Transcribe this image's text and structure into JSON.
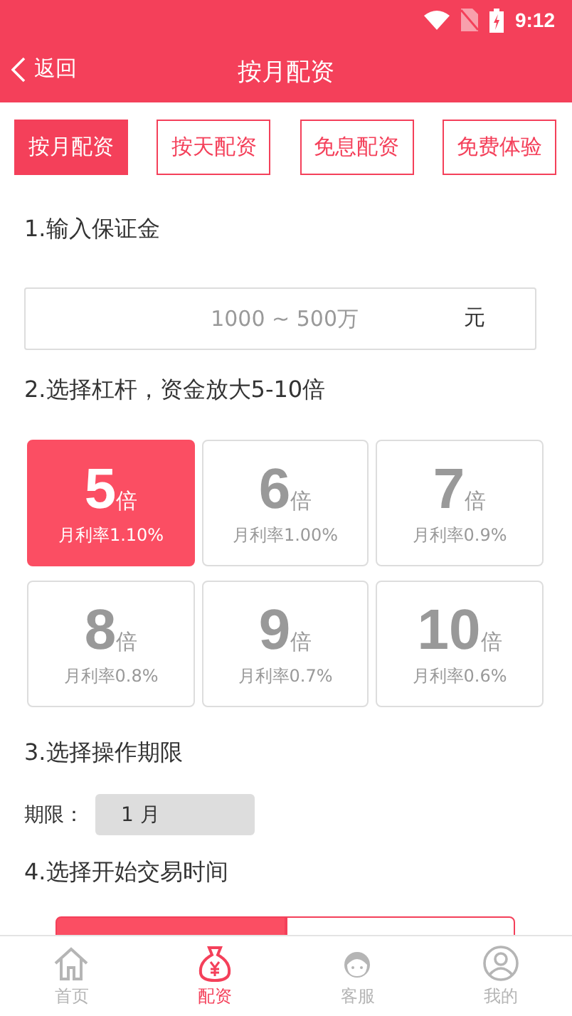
{
  "status_bar": {
    "time": "9:12"
  },
  "header": {
    "back": "返回",
    "title": "按月配资"
  },
  "tabs": [
    {
      "label": "按月配资",
      "selected": true
    },
    {
      "label": "按天配资",
      "selected": false
    },
    {
      "label": "免息配资",
      "selected": false
    },
    {
      "label": "免费体验",
      "selected": false
    }
  ],
  "deposit": {
    "heading": "1.输入保证金",
    "placeholder": "1000 ~ 500万",
    "unit": "元"
  },
  "leverage": {
    "heading": "2.选择杠杆，资金放大5-10倍",
    "options": [
      {
        "multiple": "5",
        "unit": "倍",
        "rate": "月利率1.10%",
        "selected": true
      },
      {
        "multiple": "6",
        "unit": "倍",
        "rate": "月利率1.00%",
        "selected": false
      },
      {
        "multiple": "7",
        "unit": "倍",
        "rate": "月利率0.9%",
        "selected": false
      },
      {
        "multiple": "8",
        "unit": "倍",
        "rate": "月利率0.8%",
        "selected": false
      },
      {
        "multiple": "9",
        "unit": "倍",
        "rate": "月利率0.7%",
        "selected": false
      },
      {
        "multiple": "10",
        "unit": "倍",
        "rate": "月利率0.6%",
        "selected": false
      }
    ]
  },
  "period": {
    "heading": "3.选择操作期限",
    "label": "期限：",
    "value": "1 月"
  },
  "start_time": {
    "heading": "4.选择开始交易时间",
    "options": [
      {
        "selected": true
      },
      {
        "selected": false
      }
    ]
  },
  "bottom_nav": [
    {
      "kind": "home",
      "label": "首页",
      "selected": false
    },
    {
      "kind": "money",
      "label": "配资",
      "selected": true
    },
    {
      "kind": "service",
      "label": "客服",
      "selected": false
    },
    {
      "kind": "user",
      "label": "我的",
      "selected": false
    }
  ]
}
